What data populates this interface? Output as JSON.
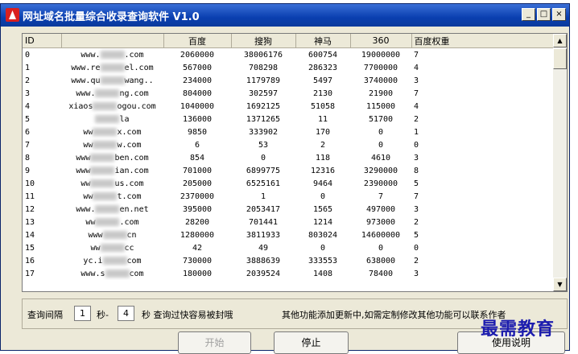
{
  "window": {
    "title": "网址域名批量综合收录查询软件 V1.0",
    "controls": [
      "_",
      "□",
      "×"
    ]
  },
  "table": {
    "columns": [
      "ID",
      "",
      "百度",
      "搜狗",
      "神马",
      "360",
      "百度权重"
    ],
    "rows": [
      [
        "0",
        "www.",
        ".com",
        "2060000",
        "38006176",
        "600754",
        "19000000",
        "7"
      ],
      [
        "1",
        "www.re",
        "el.com",
        "567000",
        "708298",
        "286323",
        "7700000",
        "4"
      ],
      [
        "2",
        "www.qu",
        "wang..",
        "234000",
        "1179789",
        "5497",
        "3740000",
        "3"
      ],
      [
        "3",
        "www.",
        "ng.com",
        "804000",
        "302597",
        "2130",
        "21900",
        "7"
      ],
      [
        "4",
        "xiaos",
        "ogou.com",
        "1040000",
        "1692125",
        "51058",
        "115000",
        "4"
      ],
      [
        "5",
        "",
        "la",
        "136000",
        "1371265",
        "11",
        "51700",
        "2"
      ],
      [
        "6",
        "ww",
        "x.com",
        "9850",
        "333902",
        "170",
        "0",
        "1"
      ],
      [
        "7",
        "ww",
        "w.com",
        "6",
        "53",
        "2",
        "0",
        "0"
      ],
      [
        "8",
        "www",
        "ben.com",
        "854",
        "0",
        "118",
        "4610",
        "3"
      ],
      [
        "9",
        "www",
        "ian.com",
        "701000",
        "6899775",
        "12316",
        "3290000",
        "8"
      ],
      [
        "10",
        "ww",
        "us.com",
        "205000",
        "6525161",
        "9464",
        "2390000",
        "5"
      ],
      [
        "11",
        "ww",
        "t.com",
        "2370000",
        "1",
        "0",
        "7",
        "7"
      ],
      [
        "12",
        "www.",
        "en.net",
        "395000",
        "2053417",
        "1565",
        "497000",
        "3"
      ],
      [
        "13",
        "ww",
        ".com",
        "28200",
        "701441",
        "1214",
        "973000",
        "2"
      ],
      [
        "14",
        "www",
        "cn",
        "1280000",
        "3811933",
        "803024",
        "14600000",
        "5"
      ],
      [
        "15",
        "ww",
        "cc",
        "42",
        "49",
        "0",
        "0",
        "0"
      ],
      [
        "16",
        "yc.i",
        "com",
        "730000",
        "3888639",
        "333553",
        "638000",
        "2"
      ],
      [
        "17",
        "www.s",
        "com",
        "180000",
        "2039524",
        "1408",
        "78400",
        "3"
      ]
    ]
  },
  "controls": {
    "interval_label": "查询间隔",
    "min_value": "1",
    "sep": "秒-",
    "max_value": "4",
    "warn": "秒 查询过快容易被封哦",
    "note": "其他功能添加更新中,如需定制修改其他功能可以联系作者"
  },
  "buttons": {
    "start": "开始",
    "stop": "停止",
    "help": "使用说明"
  },
  "watermark": "最需教育"
}
